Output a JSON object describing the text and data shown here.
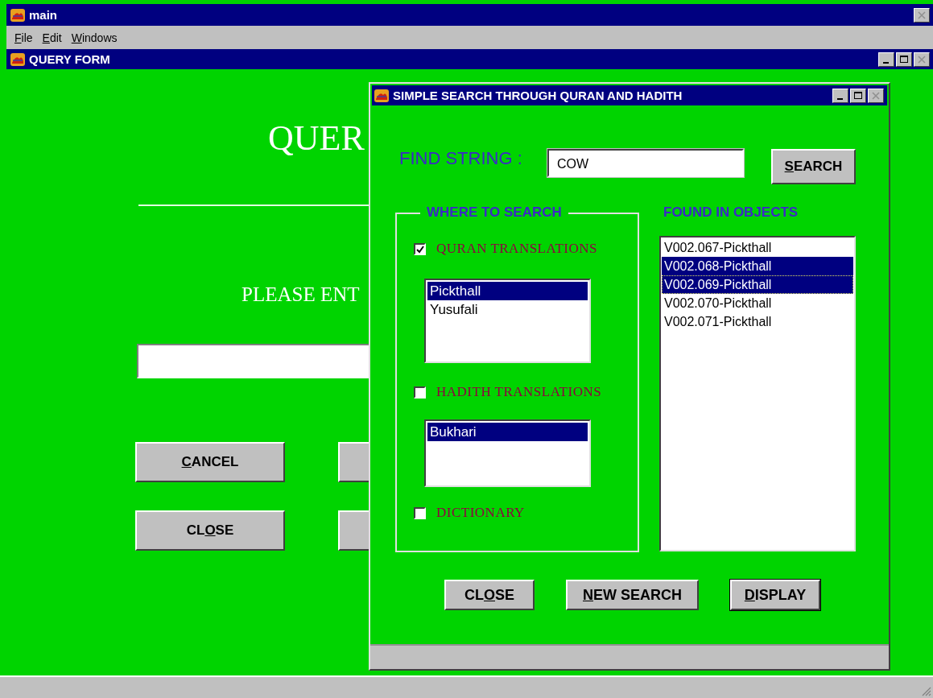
{
  "main_window": {
    "title": "main",
    "menu": [
      {
        "key": "F",
        "post": "ile"
      },
      {
        "key": "E",
        "post": "dit"
      },
      {
        "key": "W",
        "post": "indows"
      }
    ]
  },
  "query_form": {
    "title": "QUERY FORM",
    "heading": "QUER",
    "prompt": "PLEASE ENT",
    "buttons": [
      {
        "key": "C",
        "post": "ANCEL"
      },
      {
        "pre": "CL",
        "key": "O",
        "post": "SE"
      }
    ]
  },
  "dialog": {
    "title": "SIMPLE SEARCH THROUGH QURAN AND HADITH",
    "find_label": "FIND STRING :",
    "find_value": "COW",
    "search_button": {
      "key": "S",
      "post": "EARCH",
      "default": false
    },
    "group_title": "WHERE TO SEARCH",
    "sources": [
      {
        "kind": "list",
        "label": "QURAN TRANSLATIONS",
        "checked": true,
        "items": [
          {
            "text": "Pickthall",
            "selected": true
          },
          {
            "text": "Yusufali",
            "selected": false
          }
        ]
      },
      {
        "kind": "list",
        "label": "HADITH TRANSLATIONS",
        "checked": false,
        "items": [
          {
            "text": "Bukhari",
            "selected": true
          }
        ]
      },
      {
        "kind": "plain",
        "label": "DICTIONARY",
        "checked": false
      }
    ],
    "results_title": "FOUND IN OBJECTS",
    "results": [
      {
        "text": "V002.067-Pickthall",
        "selected": false,
        "focused": false
      },
      {
        "text": "V002.068-Pickthall",
        "selected": true,
        "focused": false
      },
      {
        "text": "V002.069-Pickthall",
        "selected": true,
        "focused": true
      },
      {
        "text": "V002.070-Pickthall",
        "selected": false,
        "focused": false
      },
      {
        "text": "V002.071-Pickthall",
        "selected": false,
        "focused": false
      }
    ],
    "buttons": [
      {
        "pre": "CL",
        "key": "O",
        "post": "SE",
        "default": false
      },
      {
        "key": "N",
        "post": "EW SEARCH",
        "default": false
      },
      {
        "key": "D",
        "post": "ISPLAY",
        "default": true
      }
    ]
  }
}
